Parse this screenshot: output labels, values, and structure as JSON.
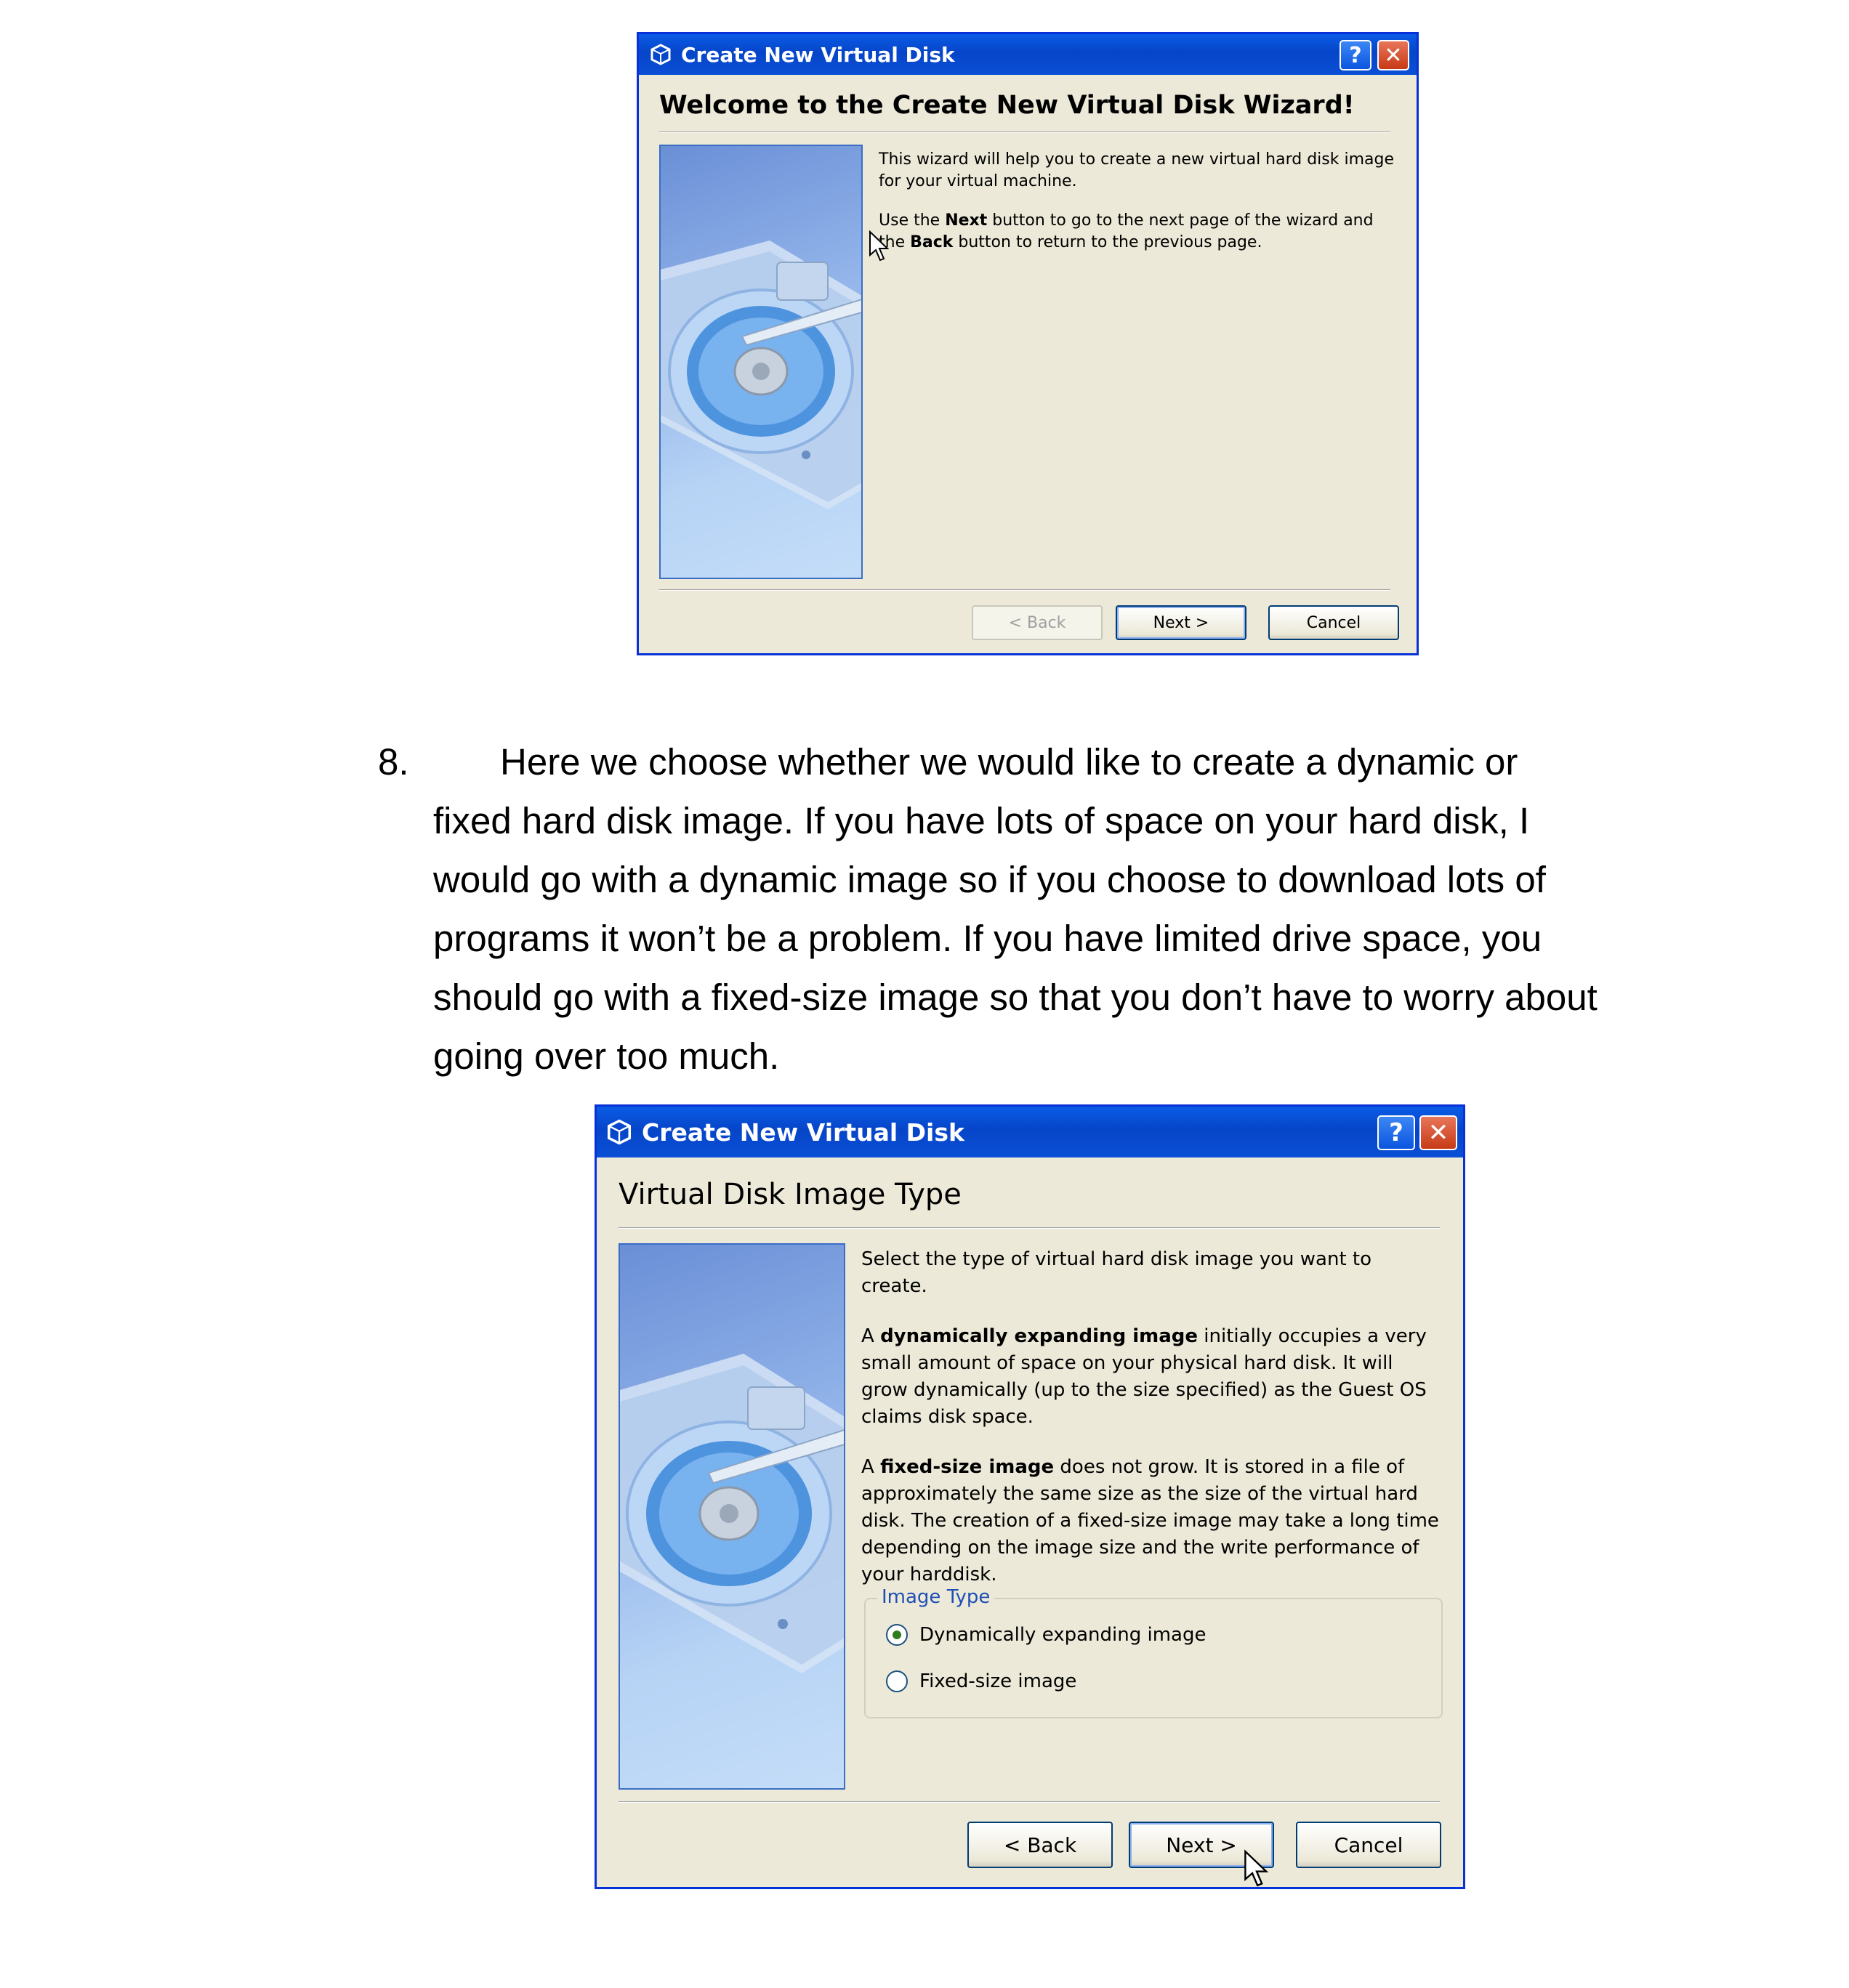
{
  "dialog1": {
    "title": "Create New Virtual Disk",
    "help_label": "?",
    "close_label": "✕",
    "header": "Welcome to the Create New Virtual Disk Wizard!",
    "para1": "This wizard will help you to create a new virtual hard disk image for your virtual machine.",
    "para2_pre": "Use the ",
    "para2_b1": "Next",
    "para2_mid": " button to go to the next page of the wizard and the ",
    "para2_b2": "Back",
    "para2_post": " button to return to the previous page.",
    "back_label": "< Back",
    "next_label": "Next >",
    "cancel_label": "Cancel"
  },
  "instruction": {
    "number": "8.",
    "text": "Here we choose whether we would like to create a dynamic or fixed hard disk image. If you have lots of space on your hard disk, I would go with a dynamic image so if you choose to download lots of programs it won’t be a problem. If you have limited drive space, you should go with a fixed-size image so that you don’t have to worry about going over too much."
  },
  "dialog2": {
    "title": "Create New Virtual Disk",
    "help_label": "?",
    "close_label": "✕",
    "header": "Virtual Disk Image Type",
    "intro": "Select the type of virtual hard disk image you want to create.",
    "dyn_pre": "A ",
    "dyn_bold": "dynamically expanding image",
    "dyn_post": " initially occupies a very small amount of space on your physical hard disk. It will grow dynamically (up to the size specified) as the Guest OS claims disk space.",
    "fixed_pre": "A ",
    "fixed_bold": "fixed-size image",
    "fixed_post": " does not grow. It is stored in a file of approximately the same size as the size of the virtual hard disk. The creation of a fixed-size image may take a long time depending on the image size and the write performance of your harddisk.",
    "group_label": "Image Type",
    "options": [
      {
        "label": "Dynamically expanding image",
        "checked": true
      },
      {
        "label": "Fixed-size image",
        "checked": false
      }
    ],
    "back_label": "< Back",
    "next_label": "Next >",
    "cancel_label": "Cancel"
  }
}
